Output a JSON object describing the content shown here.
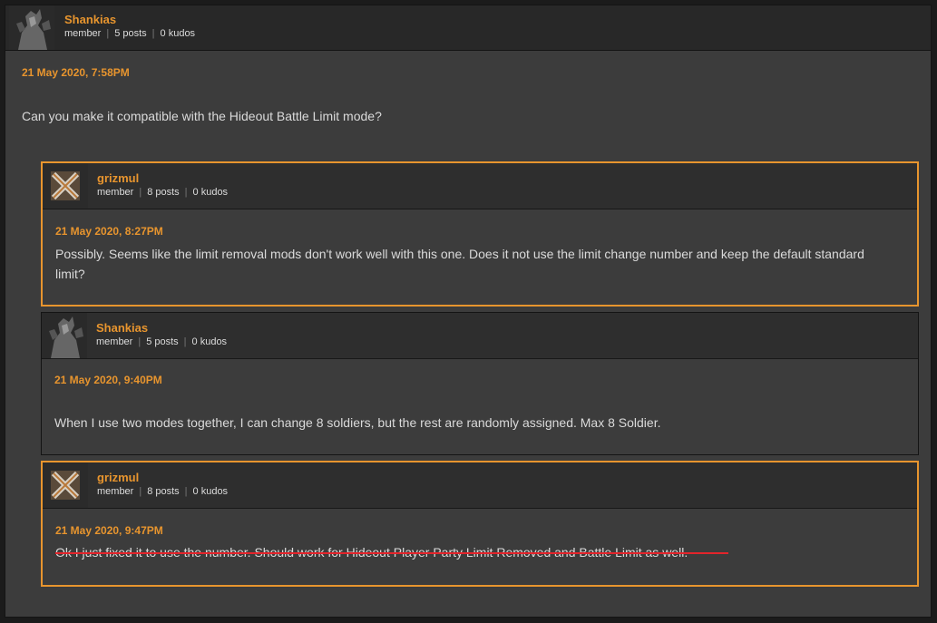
{
  "colors": {
    "accent": "#e8952e",
    "underline": "#e3242b",
    "background": "#3c3c3c"
  },
  "outer_post": {
    "username": "Shankias",
    "role": "member",
    "posts": "5 posts",
    "kudos": "0 kudos",
    "date": "21 May 2020, 7:58PM",
    "text": "Can you make it compatible with the Hideout Battle Limit mode?"
  },
  "replies": [
    {
      "username": "grizmul",
      "role": "member",
      "posts": "8 posts",
      "kudos": "0 kudos",
      "date": "21 May 2020, 8:27PM",
      "text": "Possibly. Seems like the limit removal mods don't work well with this one. Does it not use the limit change number and keep the default standard limit?"
    },
    {
      "username": "Shankias",
      "role": "member",
      "posts": "5 posts",
      "kudos": "0 kudos",
      "date": "21 May 2020, 9:40PM",
      "text": "When I use two modes together, I can change 8 soldiers, but the rest are randomly assigned. Max 8 Soldier."
    },
    {
      "username": "grizmul",
      "role": "member",
      "posts": "8 posts",
      "kudos": "0 kudos",
      "date": "21 May 2020, 9:47PM",
      "text": "Ok I just fixed it to use the number. Should work for Hideout Player Party Limit Removed and Battle Limit as well."
    }
  ]
}
